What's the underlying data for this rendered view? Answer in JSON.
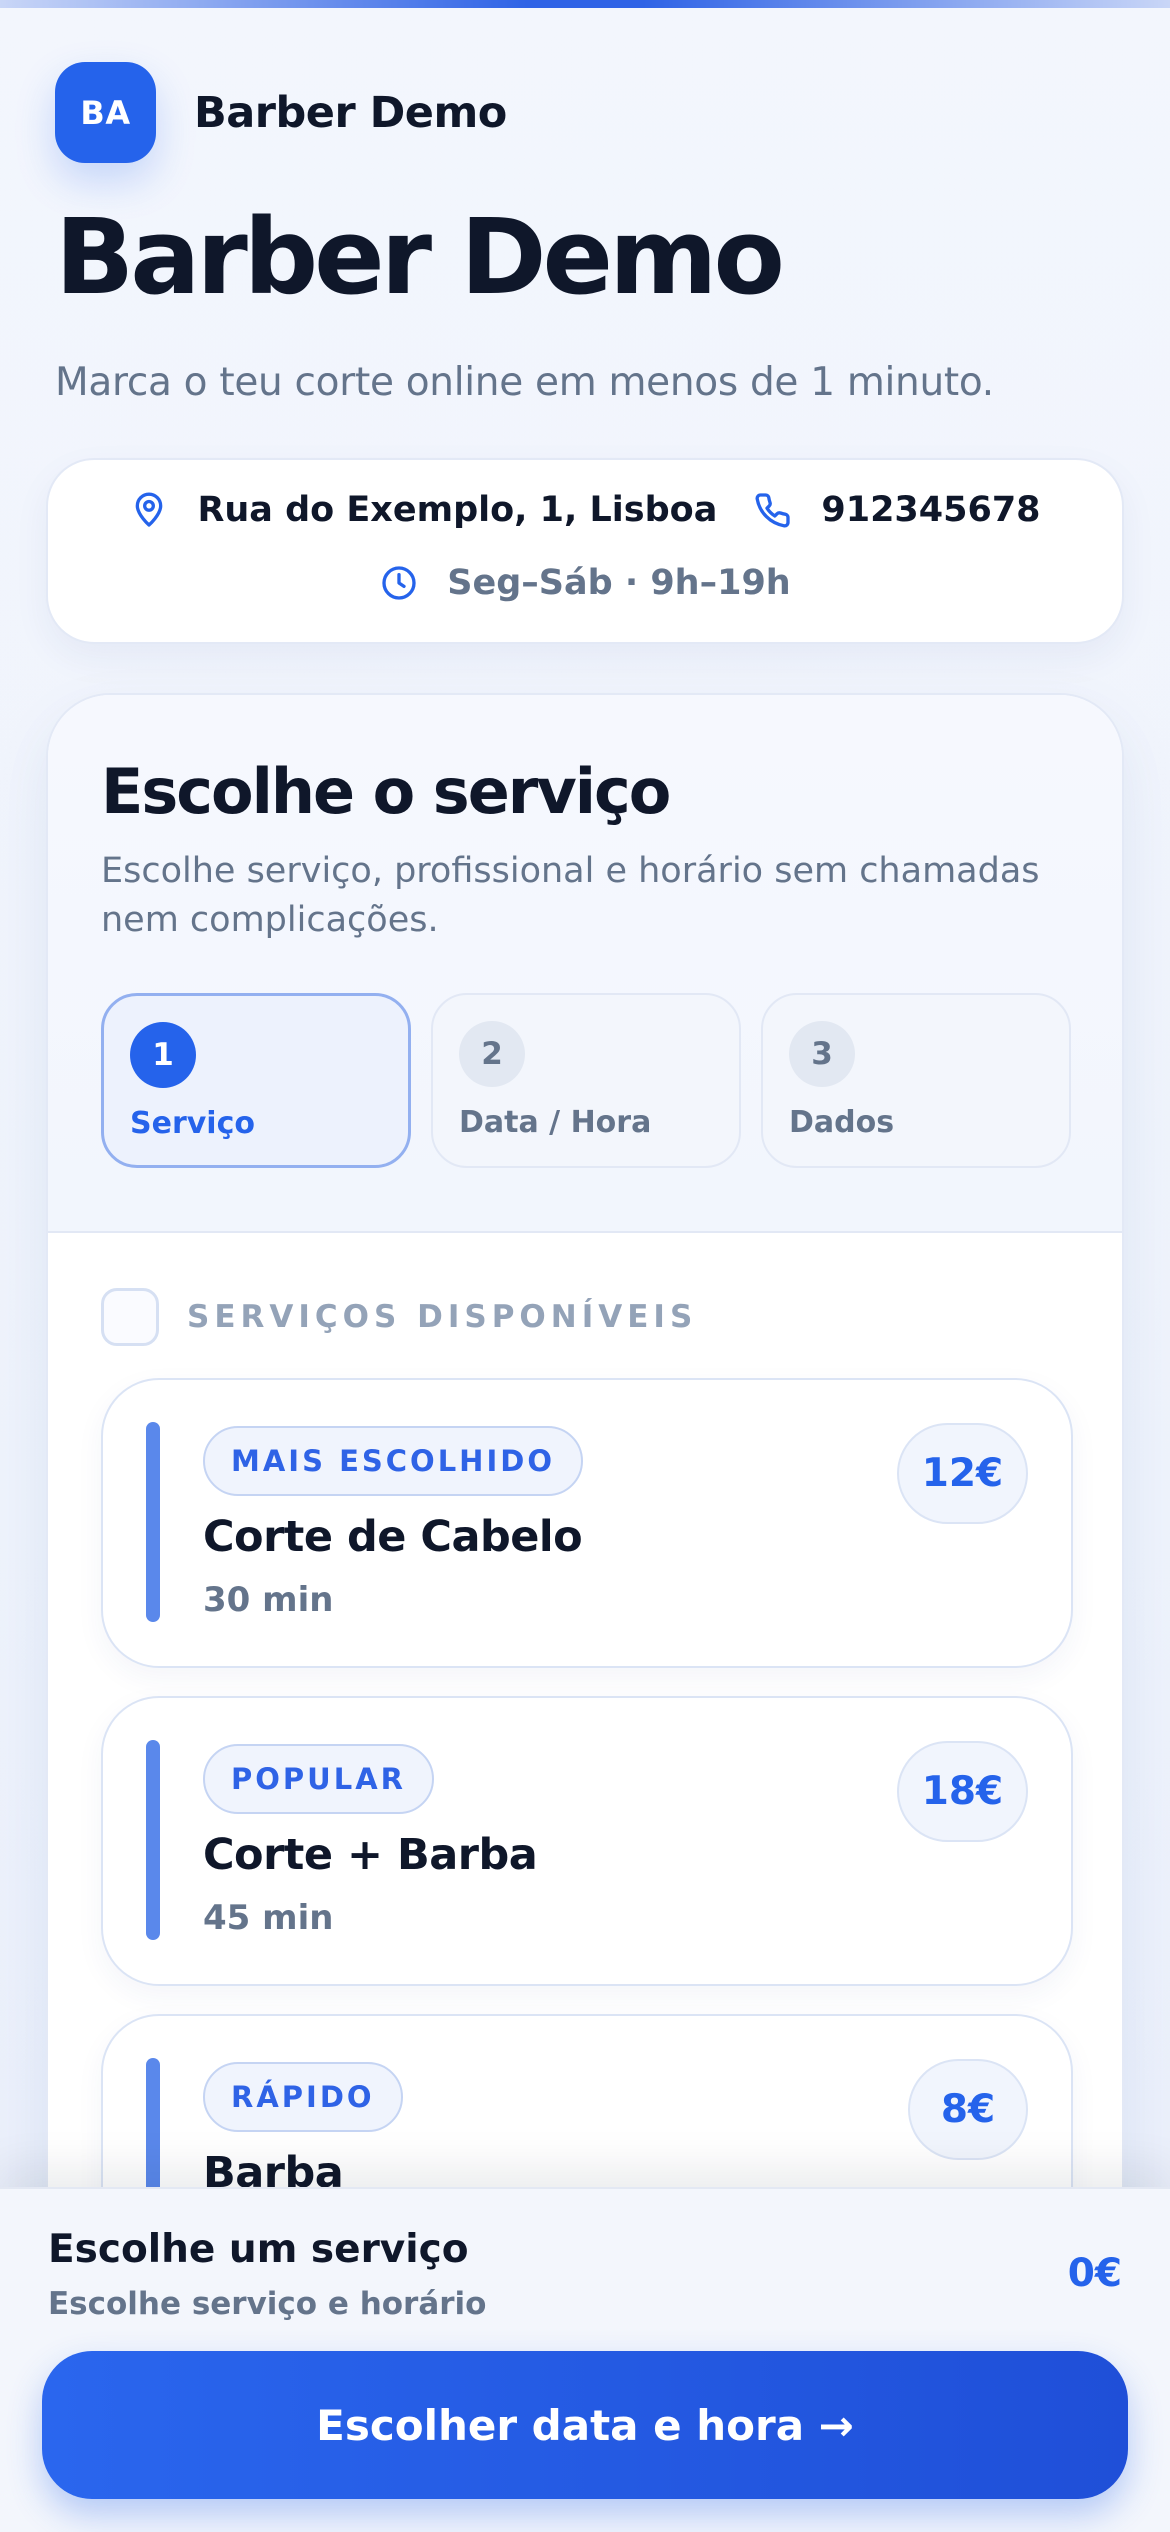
{
  "brand": {
    "initials": "BA",
    "name": "Barber Demo"
  },
  "page": {
    "title": "Barber Demo",
    "subtitle": "Marca o teu corte online em menos de 1 minuto."
  },
  "info": {
    "address": "Rua do Exemplo, 1, Lisboa",
    "phone": "912345678",
    "hours": "Seg–Sáb · 9h–19h"
  },
  "booking": {
    "title": "Escolhe o serviço",
    "description": "Escolhe serviço, profissional e horário sem chamadas nem complicações.",
    "steps": [
      {
        "number": "1",
        "label": "Serviço",
        "active": true
      },
      {
        "number": "2",
        "label": "Data / Hora",
        "active": false
      },
      {
        "number": "3",
        "label": "Dados",
        "active": false
      }
    ],
    "services_label": "SERVIÇOS DISPONÍVEIS",
    "services": [
      {
        "tag": "MAIS ESCOLHIDO",
        "name": "Corte de Cabelo",
        "duration": "30 min",
        "price": "12€"
      },
      {
        "tag": "POPULAR",
        "name": "Corte + Barba",
        "duration": "45 min",
        "price": "18€"
      },
      {
        "tag": "RÁPIDO",
        "name": "Barba",
        "duration": "",
        "price": "8€"
      }
    ]
  },
  "footer": {
    "title": "Escolhe um serviço",
    "subtitle": "Escolhe serviço e horário",
    "total": "0€",
    "cta_label": "Escolher data e hora →"
  },
  "colors": {
    "accent": "#2563eb",
    "text": "#0f172a",
    "muted": "#64748b"
  },
  "icons": {
    "address": "map-pin-icon",
    "phone": "phone-icon",
    "hours": "clock-icon"
  }
}
